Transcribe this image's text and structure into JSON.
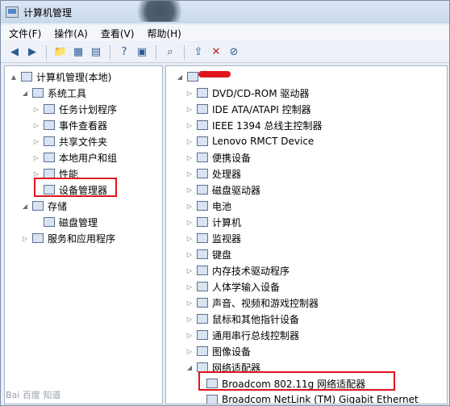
{
  "window": {
    "title": "计算机管理"
  },
  "menu": [
    "文件(F)",
    "操作(A)",
    "查看(V)",
    "帮助(H)"
  ],
  "toolbar": {
    "icons": [
      "back-icon",
      "forward-icon",
      "up-icon",
      "show-tree-icon",
      "properties-icon",
      "help-icon",
      "view-icon",
      "scan-hardware-icon",
      "update-driver-icon",
      "uninstall-icon",
      "disable-icon"
    ]
  },
  "left_tree": [
    {
      "label": "计算机管理(本地)",
      "level": 0,
      "expander": "▲",
      "icon": "computer-management-icon"
    },
    {
      "label": "系统工具",
      "level": 1,
      "expander": "◢",
      "icon": "tools-icon"
    },
    {
      "label": "任务计划程序",
      "level": 2,
      "expander": "▷",
      "icon": "clock-icon"
    },
    {
      "label": "事件查看器",
      "level": 2,
      "expander": "▷",
      "icon": "event-viewer-icon"
    },
    {
      "label": "共享文件夹",
      "level": 2,
      "expander": "▷",
      "icon": "shared-folder-icon"
    },
    {
      "label": "本地用户和组",
      "level": 2,
      "expander": "▷",
      "icon": "users-icon"
    },
    {
      "label": "性能",
      "level": 2,
      "expander": "▷",
      "icon": "performance-icon"
    },
    {
      "label": "设备管理器",
      "level": 2,
      "expander": "",
      "icon": "device-manager-icon"
    },
    {
      "label": "存储",
      "level": 1,
      "expander": "◢",
      "icon": "storage-icon"
    },
    {
      "label": "磁盘管理",
      "level": 2,
      "expander": "",
      "icon": "disk-management-icon"
    },
    {
      "label": "服务和应用程序",
      "level": 1,
      "expander": "▷",
      "icon": "services-icon"
    }
  ],
  "right_tree": [
    {
      "label": "",
      "level": 0,
      "expander": "◢",
      "icon": "computer-icon"
    },
    {
      "label": "DVD/CD-ROM 驱动器",
      "level": 1,
      "expander": "▷",
      "icon": "dvd-icon"
    },
    {
      "label": "IDE ATA/ATAPI 控制器",
      "level": 1,
      "expander": "▷",
      "icon": "ide-icon"
    },
    {
      "label": "IEEE 1394 总线主控制器",
      "level": 1,
      "expander": "▷",
      "icon": "firewire-icon"
    },
    {
      "label": "Lenovo RMCT Device",
      "level": 1,
      "expander": "▷",
      "icon": "network-device-icon"
    },
    {
      "label": "便携设备",
      "level": 1,
      "expander": "▷",
      "icon": "portable-device-icon"
    },
    {
      "label": "处理器",
      "level": 1,
      "expander": "▷",
      "icon": "processor-icon"
    },
    {
      "label": "磁盘驱动器",
      "level": 1,
      "expander": "▷",
      "icon": "disk-drive-icon"
    },
    {
      "label": "电池",
      "level": 1,
      "expander": "▷",
      "icon": "battery-icon"
    },
    {
      "label": "计算机",
      "level": 1,
      "expander": "▷",
      "icon": "computer-icon"
    },
    {
      "label": "监视器",
      "level": 1,
      "expander": "▷",
      "icon": "monitor-icon"
    },
    {
      "label": "键盘",
      "level": 1,
      "expander": "▷",
      "icon": "keyboard-icon"
    },
    {
      "label": "内存技术驱动程序",
      "level": 1,
      "expander": "▷",
      "icon": "memory-icon"
    },
    {
      "label": "人体学输入设备",
      "level": 1,
      "expander": "▷",
      "icon": "hid-icon"
    },
    {
      "label": "声音、视频和游戏控制器",
      "level": 1,
      "expander": "▷",
      "icon": "sound-icon"
    },
    {
      "label": "鼠标和其他指针设备",
      "level": 1,
      "expander": "▷",
      "icon": "mouse-icon"
    },
    {
      "label": "通用串行总线控制器",
      "level": 1,
      "expander": "▷",
      "icon": "usb-icon"
    },
    {
      "label": "图像设备",
      "level": 1,
      "expander": "▷",
      "icon": "imaging-icon"
    },
    {
      "label": "网络适配器",
      "level": 1,
      "expander": "◢",
      "icon": "network-adapter-icon"
    },
    {
      "label": "Broadcom 802.11g 网络适配器",
      "level": 2,
      "expander": "",
      "icon": "network-adapter-icon"
    },
    {
      "label": "Broadcom NetLink (TM) Gigabit Ethernet",
      "level": 2,
      "expander": "",
      "icon": "network-adapter-icon"
    }
  ],
  "watermark": "Bai 百度 知道",
  "highlight_color": "#e0141e"
}
